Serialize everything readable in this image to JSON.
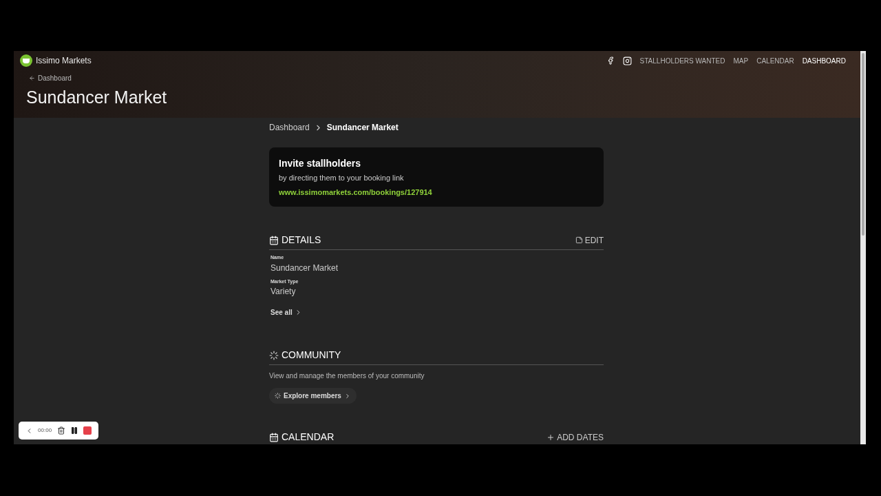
{
  "header": {
    "brand": "Issimo Markets",
    "back_link": "Dashboard",
    "title": "Sundancer Market",
    "nav": [
      {
        "label": "STALLHOLDERS WANTED",
        "selected": false
      },
      {
        "label": "MAP",
        "selected": false
      },
      {
        "label": "CALENDAR",
        "selected": false
      },
      {
        "label": "DASHBOARD",
        "selected": true
      }
    ]
  },
  "breadcrumb": [
    "Dashboard",
    "Sundancer Market"
  ],
  "invite": {
    "title": "Invite stallholders",
    "subtitle": "by directing them to your booking link",
    "link": "www.issimomarkets.com/bookings/127914"
  },
  "details": {
    "heading": "DETAILS",
    "action": "EDIT",
    "fields": [
      {
        "label": "Name",
        "value": "Sundancer Market"
      },
      {
        "label": "Market Type",
        "value": "Variety"
      }
    ],
    "see_all": "See all"
  },
  "community": {
    "heading": "COMMUNITY",
    "text": "View and manage the members of your community",
    "button": "Explore members"
  },
  "calendar": {
    "heading": "CALENDAR",
    "action": "ADD DATES"
  },
  "recorder": {
    "time": "00:00"
  }
}
